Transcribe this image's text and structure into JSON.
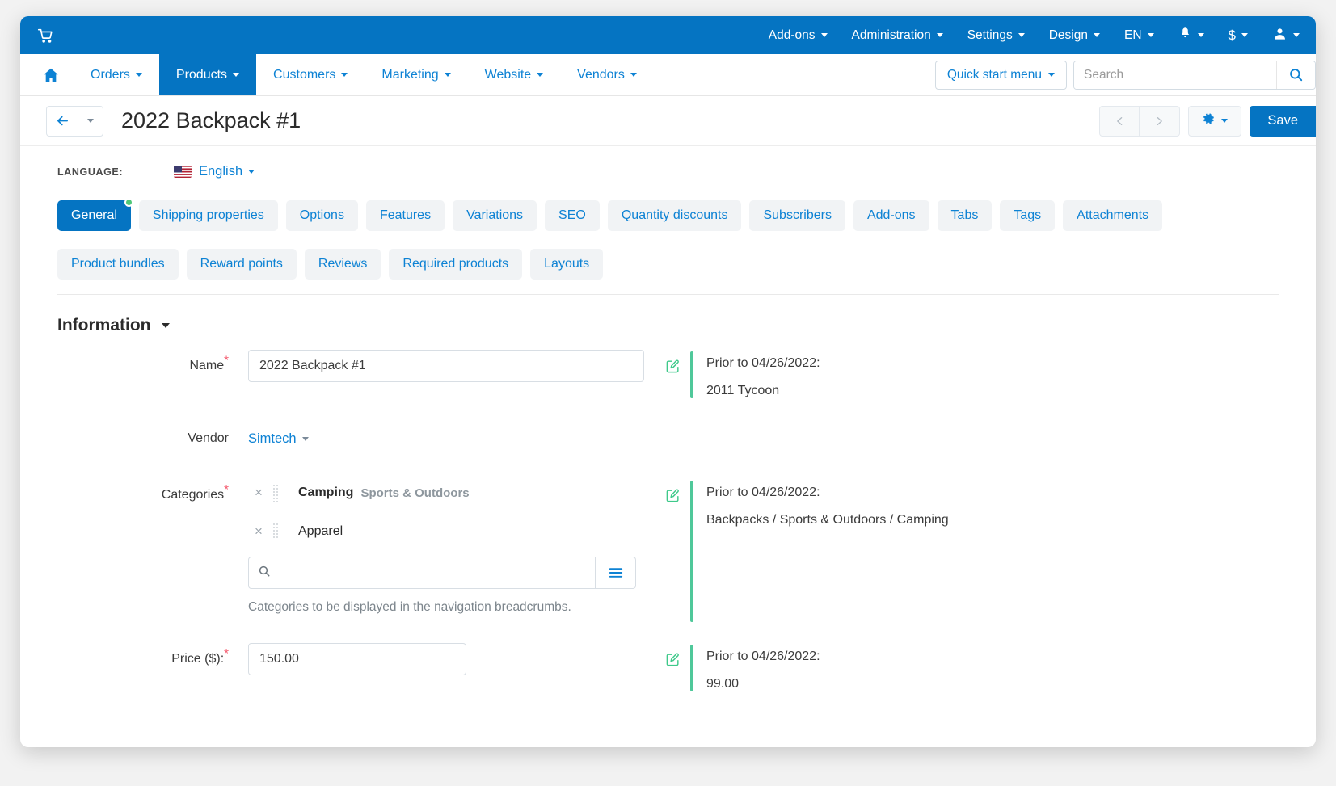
{
  "topbar": {
    "logo_icon": "shopping-cart-icon",
    "menus": [
      {
        "label": "Add-ons",
        "icon": "chevron-down-icon"
      },
      {
        "label": "Administration",
        "icon": "chevron-down-icon"
      },
      {
        "label": "Settings",
        "icon": "chevron-down-icon"
      },
      {
        "label": "Design",
        "icon": "chevron-down-icon"
      },
      {
        "label": "EN",
        "icon": "chevron-down-icon"
      }
    ],
    "notifications_icon": "bell-icon",
    "currency_label": "$",
    "currency_icon": "dollar-icon",
    "account_icon": "user-icon"
  },
  "mainnav": {
    "home_icon": "home-icon",
    "items": [
      {
        "label": "Orders",
        "active": false
      },
      {
        "label": "Products",
        "active": true
      },
      {
        "label": "Customers",
        "active": false
      },
      {
        "label": "Marketing",
        "active": false
      },
      {
        "label": "Website",
        "active": false
      },
      {
        "label": "Vendors",
        "active": false
      }
    ],
    "quick_start_label": "Quick start menu",
    "search_placeholder": "Search",
    "search_value": "",
    "search_icon": "search-icon"
  },
  "titlebar": {
    "back_icon": "arrow-left-icon",
    "back_caret_icon": "chevron-down-icon",
    "title": "2022 Backpack #1",
    "prev_icon": "chevron-left-icon",
    "next_icon": "chevron-right-icon",
    "gear_icon": "gear-icon",
    "save_label": "Save"
  },
  "language": {
    "label": "LANGUAGE:",
    "flag_icon": "us-flag-icon",
    "value": "English"
  },
  "tabs": [
    {
      "label": "General",
      "active": true,
      "badge": true
    },
    {
      "label": "Shipping properties",
      "active": false,
      "badge": false
    },
    {
      "label": "Options",
      "active": false,
      "badge": false
    },
    {
      "label": "Features",
      "active": false,
      "badge": false
    },
    {
      "label": "Variations",
      "active": false,
      "badge": false
    },
    {
      "label": "SEO",
      "active": false,
      "badge": false
    },
    {
      "label": "Quantity discounts",
      "active": false,
      "badge": false
    },
    {
      "label": "Subscribers",
      "active": false,
      "badge": false
    },
    {
      "label": "Add-ons",
      "active": false,
      "badge": false
    },
    {
      "label": "Tabs",
      "active": false,
      "badge": false
    },
    {
      "label": "Tags",
      "active": false,
      "badge": false
    },
    {
      "label": "Attachments",
      "active": false,
      "badge": false
    },
    {
      "label": "Product bundles",
      "active": false,
      "badge": false
    },
    {
      "label": "Reward points",
      "active": false,
      "badge": false
    },
    {
      "label": "Reviews",
      "active": false,
      "badge": false
    },
    {
      "label": "Required products",
      "active": false,
      "badge": false
    },
    {
      "label": "Layouts",
      "active": false,
      "badge": false
    }
  ],
  "section": {
    "title": "Information",
    "caret_icon": "chevron-down-icon"
  },
  "form": {
    "name": {
      "label": "Name",
      "required": true,
      "value": "2022 Backpack #1",
      "prior_heading": "Prior to 04/26/2022:",
      "prior_value": "2011 Tycoon",
      "edit_icon": "pencil-square-icon"
    },
    "vendor": {
      "label": "Vendor",
      "required": false,
      "value": "Simtech",
      "caret_icon": "chevron-down-icon"
    },
    "categories": {
      "label": "Categories",
      "required": true,
      "items": [
        {
          "name": "Camping",
          "path": "Sports & Outdoors",
          "remove_icon": "close-icon",
          "grip_icon": "drag-handle-icon"
        },
        {
          "name": "Apparel",
          "path": "",
          "remove_icon": "close-icon",
          "grip_icon": "drag-handle-icon"
        }
      ],
      "search_value": "",
      "search_placeholder": "",
      "search_icon": "search-icon",
      "list_icon": "list-icon",
      "help": "Categories to be displayed in the navigation breadcrumbs.",
      "prior_heading": "Prior to 04/26/2022:",
      "prior_value": "Backpacks / Sports & Outdoors / Camping",
      "edit_icon": "pencil-square-icon"
    },
    "price": {
      "label": "Price ($):",
      "required": true,
      "value": "150.00",
      "prior_heading": "Prior to 04/26/2022:",
      "prior_value": "99.00",
      "edit_icon": "pencil-square-icon"
    }
  },
  "colors": {
    "brand_blue": "#0574c2",
    "link_blue": "#0d82d4",
    "accent_green": "#4fc89a",
    "required_red": "#f4566a",
    "tab_bg": "#f1f3f5"
  }
}
